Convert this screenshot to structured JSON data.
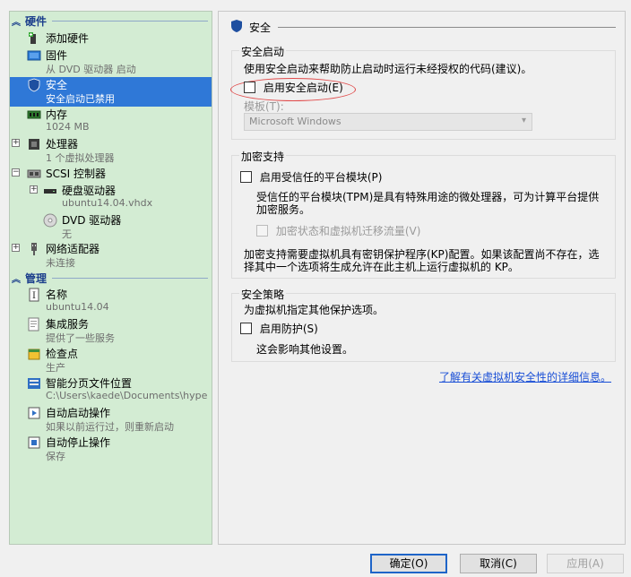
{
  "sidebar": {
    "hardware_header": "硬件",
    "management_header": "管理",
    "hardware_items": [
      {
        "label": "添加硬件",
        "sub": ""
      },
      {
        "label": "固件",
        "sub": "从 DVD 驱动器 启动"
      },
      {
        "label": "安全",
        "sub": "安全启动已禁用"
      },
      {
        "label": "内存",
        "sub": "1024 MB"
      },
      {
        "label": "处理器",
        "sub": "1 个虚拟处理器"
      },
      {
        "label": "SCSI 控制器",
        "sub": ""
      },
      {
        "label": "硬盘驱动器",
        "sub": "ubuntu14.04.vhdx"
      },
      {
        "label": "DVD 驱动器",
        "sub": "无"
      },
      {
        "label": "网络适配器",
        "sub": "未连接"
      }
    ],
    "management_items": [
      {
        "label": "名称",
        "sub": "ubuntu14.04"
      },
      {
        "label": "集成服务",
        "sub": "提供了一些服务"
      },
      {
        "label": "检查点",
        "sub": "生产"
      },
      {
        "label": "智能分页文件位置",
        "sub": "C:\\Users\\kaede\\Documents\\hyper..."
      },
      {
        "label": "自动启动操作",
        "sub": "如果以前运行过，则重新启动"
      },
      {
        "label": "自动停止操作",
        "sub": "保存"
      }
    ]
  },
  "main": {
    "title": "安全",
    "secure_boot": {
      "group_label": "安全启动",
      "description": "使用安全启动来帮助防止启动时运行未经授权的代码(建议)。",
      "enable_label": "启用安全启动(E)",
      "template_label": "模板(T):",
      "template_value": "Microsoft Windows"
    },
    "encryption": {
      "group_label": "加密支持",
      "tpm_label": "启用受信任的平台模块(P)",
      "tpm_desc_line1": "受信任的平台模块(TPM)是具有特殊用途的微处理器，可为计算平台提供",
      "tpm_desc_line2": "加密服务。",
      "encrypt_state_label": "加密状态和虚拟机迁移流量(V)",
      "kp_desc_line1": "加密支持需要虚拟机具有密钥保护程序(KP)配置。如果该配置尚不存在，选",
      "kp_desc_line2": "择其中一个选项将生成允许在此主机上运行虚拟机的 KP。"
    },
    "security_policy": {
      "group_label": "安全策略",
      "description": "为虚拟机指定其他保护选项。",
      "shielding_label": "启用防护(S)",
      "shielding_desc": "这会影响其他设置。"
    },
    "learn_more_link": "了解有关虚拟机安全性的详细信息。"
  },
  "buttons": {
    "ok": "确定(O)",
    "cancel": "取消(C)",
    "apply": "应用(A)"
  },
  "colors": {
    "sidebar_bg": "#d3ecd3",
    "selected_bg": "#2f78d7",
    "header_color": "#1c3f8c",
    "link_color": "#1a4fd6",
    "highlight_ellipse": "#e04a4a"
  }
}
